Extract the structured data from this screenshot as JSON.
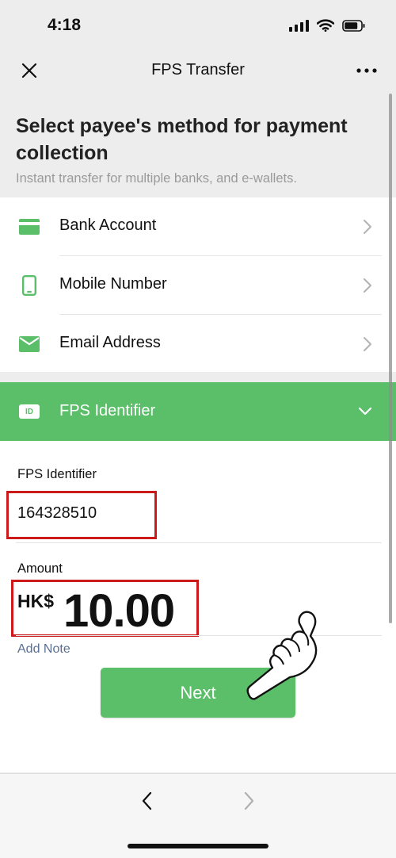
{
  "status_bar": {
    "time": "4:18"
  },
  "nav": {
    "title": "FPS Transfer"
  },
  "heading": {
    "title": "Select payee's method for payment collection",
    "subtitle": "Instant transfer for multiple banks, and e-wallets."
  },
  "methods": [
    {
      "label": "Bank Account",
      "icon": "card-icon"
    },
    {
      "label": "Mobile Number",
      "icon": "phone-icon"
    },
    {
      "label": "Email Address",
      "icon": "envelope-icon"
    }
  ],
  "fps": {
    "label": "FPS Identifier",
    "icon_text": "ID",
    "icon": "id-icon",
    "expanded": true
  },
  "form": {
    "id_label": "FPS Identifier",
    "id_value": "164328510",
    "amount_label": "Amount",
    "currency": "HK$",
    "amount_value": "10.00",
    "add_note": "Add Note",
    "next_label": "Next"
  },
  "colors": {
    "accent": "#5bbf6a",
    "highlight": "#cc1a1a",
    "link": "#5a6f92"
  }
}
